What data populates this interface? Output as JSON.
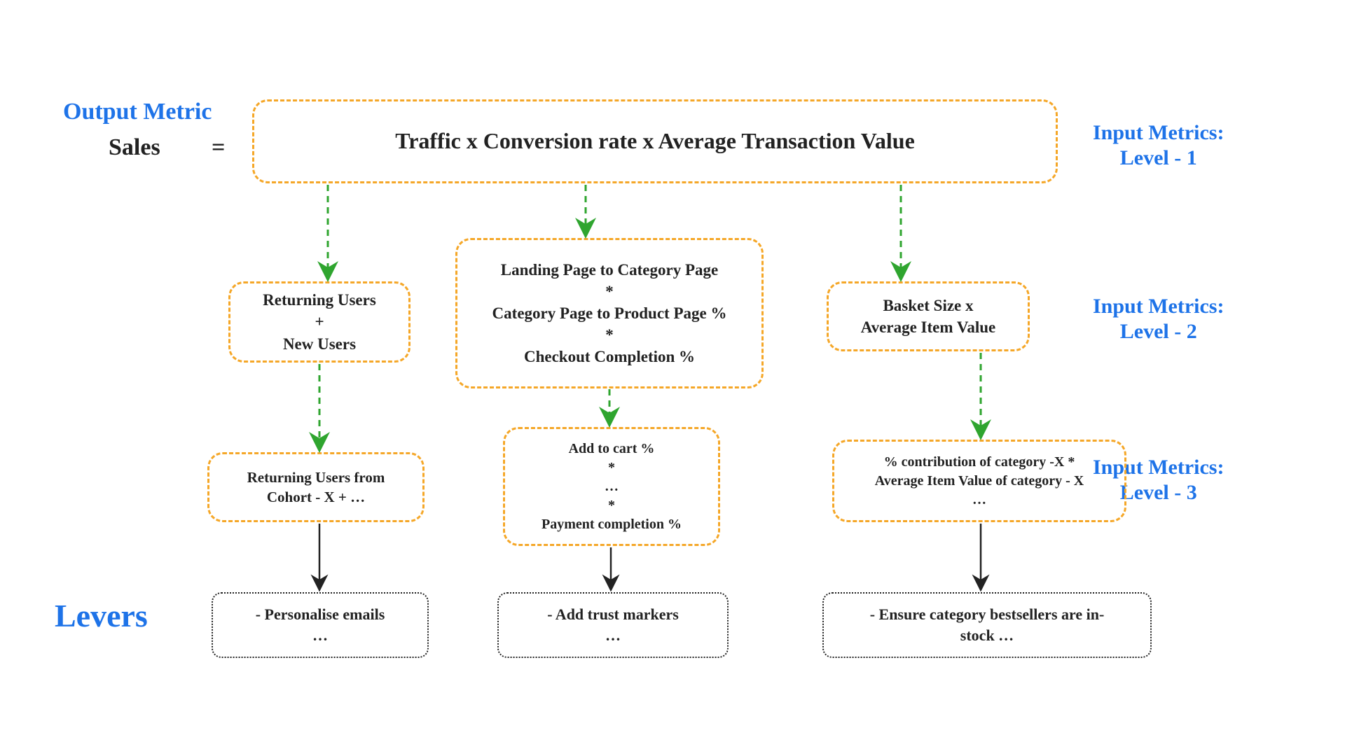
{
  "labels": {
    "output_metric": "Output Metric",
    "sales": "Sales",
    "equals": "=",
    "level1_label": "Input Metrics:\nLevel - 1",
    "level2_label": "Input Metrics:\nLevel - 2",
    "level3_label": "Input Metrics:\nLevel - 3",
    "levers": "Levers"
  },
  "level1": {
    "formula": "Traffic    x    Conversion rate   x   Average Transaction Value"
  },
  "level2": {
    "traffic": "Returning Users\n+\nNew Users",
    "conversion": "Landing Page to Category Page\n*\nCategory Page to Product Page %\n*\nCheckout Completion %",
    "atv": "Basket Size x\nAverage Item Value"
  },
  "level3": {
    "traffic": "Returning Users from\nCohort - X + …",
    "conversion": "Add to cart %\n*\n…\n*\nPayment completion %",
    "atv": "% contribution of category -X *\nAverage Item Value of category - X\n…"
  },
  "levers_boxes": {
    "traffic": "- Personalise emails\n…",
    "conversion": "- Add trust markers\n…",
    "atv": "- Ensure category bestsellers are in-\nstock …"
  }
}
